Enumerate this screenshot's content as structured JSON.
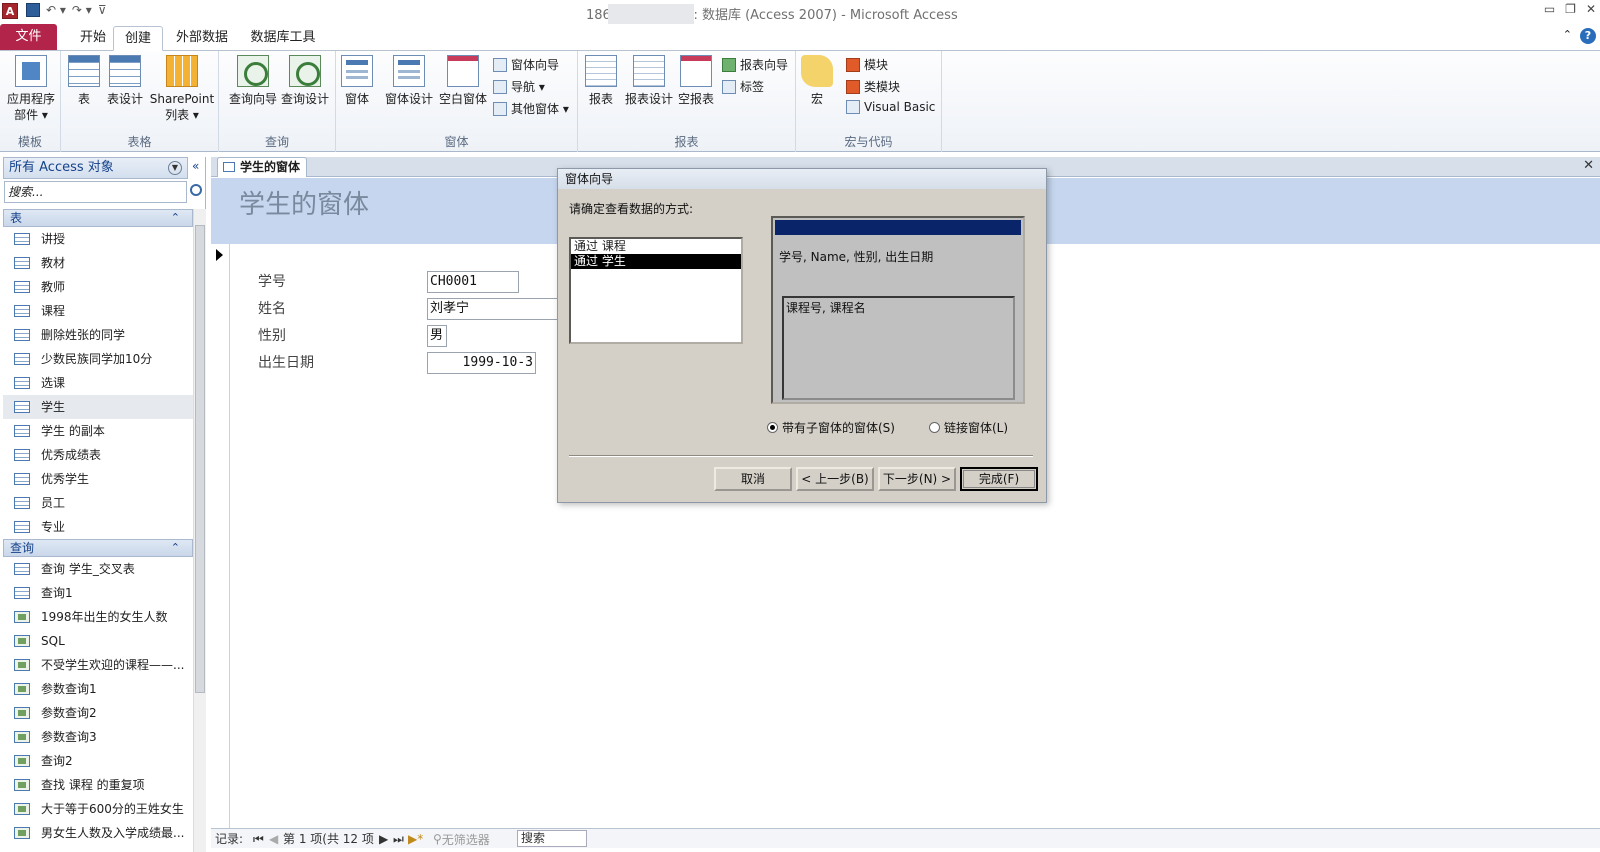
{
  "window": {
    "title": "186 -教学管理-表 : 数据库 (Access 2007) - Microsoft Access",
    "app_icon_letter": "A"
  },
  "ribbon_tabs": [
    "文件",
    "开始",
    "创建",
    "外部数据",
    "数据库工具"
  ],
  "ribbon": {
    "templates": {
      "app_parts": "应用程序",
      "app_parts2": "部件 ▾",
      "group": "模板"
    },
    "tables": {
      "table": "表",
      "table_design": "表设计",
      "sharepoint": "SharePoint",
      "sharepoint2": "列表 ▾",
      "group": "表格"
    },
    "queries": {
      "wizard": "查询向导",
      "design": "查询设计",
      "group": "查询"
    },
    "forms": {
      "form": "窗体",
      "design": "窗体设计",
      "blank": "空白窗体",
      "wizard": "窗体向导",
      "nav": "导航 ▾",
      "more": "其他窗体 ▾",
      "group": "窗体"
    },
    "reports": {
      "report": "报表",
      "design": "报表设计",
      "blank": "空报表",
      "wizard": "报表向导",
      "label": "标签",
      "group": "报表"
    },
    "macros": {
      "macro": "宏",
      "module": "模块",
      "class_module": "类模块",
      "vb": "Visual Basic",
      "group": "宏与代码"
    }
  },
  "nav_pane": {
    "header": "所有 Access 对象",
    "search_placeholder": "搜索...",
    "tables_header": "表",
    "tables": [
      "讲授",
      "教材",
      "教师",
      "课程",
      "删除姓张的同学",
      "少数民族同学加10分",
      "选课",
      "学生",
      "学生 的副本",
      "优秀成绩表",
      "优秀学生",
      "员工",
      "专业"
    ],
    "selected_table": "学生",
    "queries_header": "查询",
    "queries": [
      "查询 学生_交叉表",
      "查询1",
      "1998年出生的女生人数",
      "SQL",
      "不受学生欢迎的课程——...",
      "参数查询1",
      "参数查询2",
      "参数查询3",
      "查询2",
      "查找 课程 的重复项",
      "大于等于600分的王姓女生",
      "男女生人数及入学成绩最..."
    ]
  },
  "document": {
    "tab_label": "学生的窗体",
    "form_title": "学生的窗体",
    "fields": [
      {
        "label": "学号",
        "value": "CH0001"
      },
      {
        "label": "姓名",
        "value": "刘孝宁"
      },
      {
        "label": "性别",
        "value": "男"
      },
      {
        "label": "出生日期",
        "value": "1999-10-3"
      }
    ]
  },
  "record_bar": {
    "label": "记录:",
    "position": "第 1 项(共 12 项",
    "filter": "无筛选器",
    "search": "搜索"
  },
  "dialog": {
    "title": "窗体向导",
    "prompt": "请确定查看数据的方式:",
    "options": [
      "通过 课程",
      "通过 学生"
    ],
    "selected_option": "通过 学生",
    "main_fields": "学号, Name, 性别, 出生日期",
    "sub_fields": "课程号, 课程名",
    "radio_sub": "带有子窗体的窗体(S)",
    "radio_linked": "链接窗体(L)",
    "radio_selected": "带有子窗体的窗体(S)",
    "buttons": {
      "cancel": "取消",
      "back": "< 上一步(B)",
      "next": "下一步(N) >",
      "finish": "完成(F)"
    }
  }
}
